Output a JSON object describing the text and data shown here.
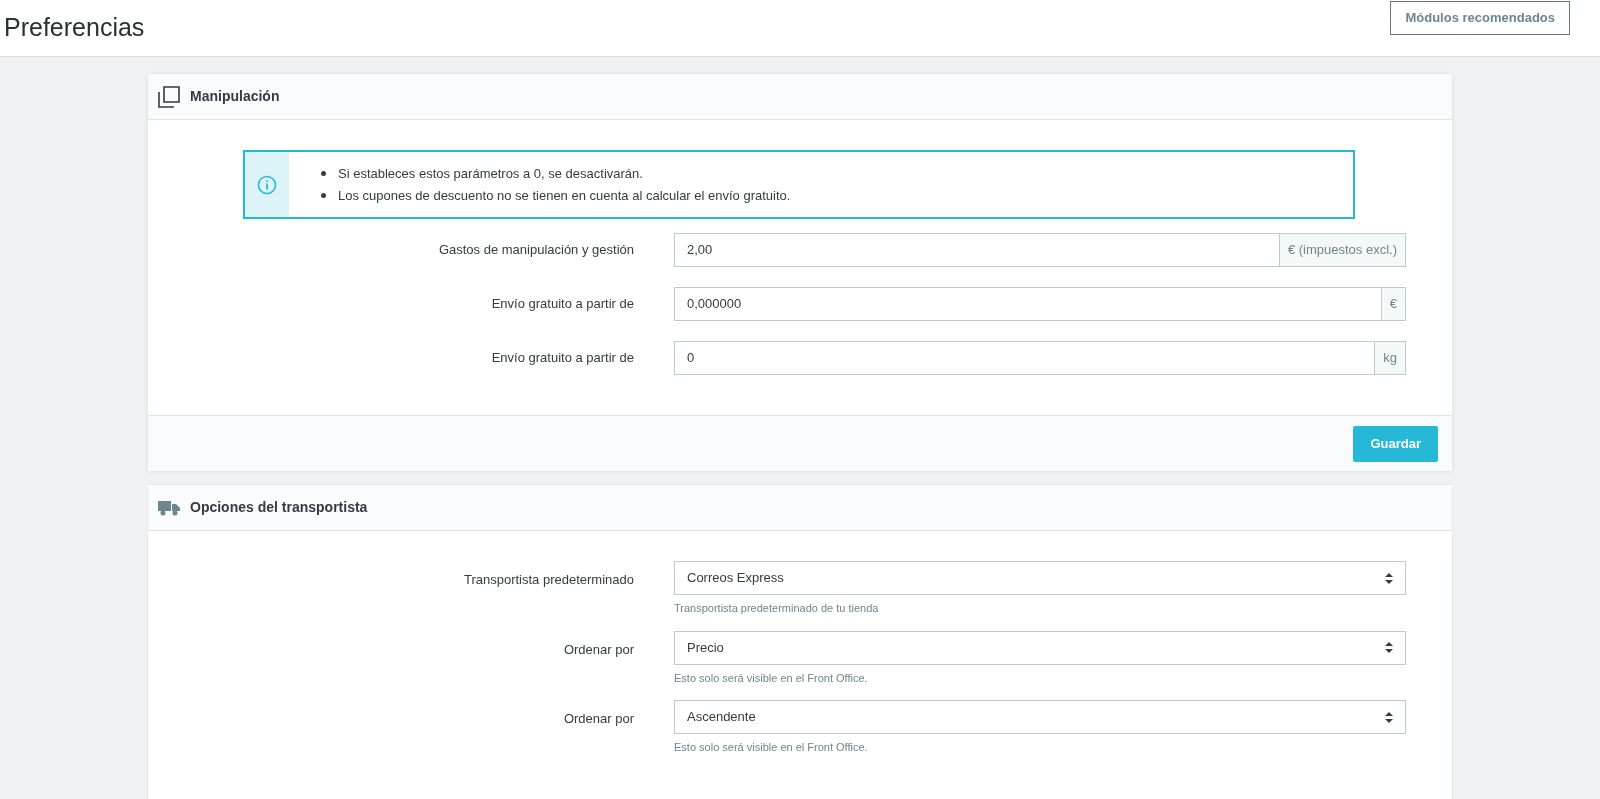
{
  "page": {
    "title": "Preferencias",
    "header_button": "Módulos recomendados"
  },
  "handling": {
    "title": "Manipulación",
    "notes": [
      "Si estableces estos parámetros a 0, se desactivarán.",
      "Los cupones de descuento no se tienen en cuenta al calcular el envío gratuito."
    ],
    "fields": [
      {
        "label": "Gastos de manipulación y gestión",
        "value": "2,00",
        "addon": "€ (impuestos excl.)"
      },
      {
        "label": "Envío gratuito a partir de",
        "value": "0,000000",
        "addon": "€"
      },
      {
        "label": "Envío gratuito a partir de",
        "value": "0",
        "addon": "kg"
      }
    ],
    "save_button": "Guardar"
  },
  "carrier": {
    "title": "Opciones del transportista",
    "fields": [
      {
        "label": "Transportista predeterminado",
        "value": "Correos Express",
        "help": "Transportista predeterminado de tu tienda"
      },
      {
        "label": "Ordenar por",
        "value": "Precio",
        "help": "Esto solo será visible en el Front Office."
      },
      {
        "label": "Ordenar por",
        "value": "Ascendente",
        "help": "Esto solo será visible en el Front Office."
      }
    ]
  }
}
